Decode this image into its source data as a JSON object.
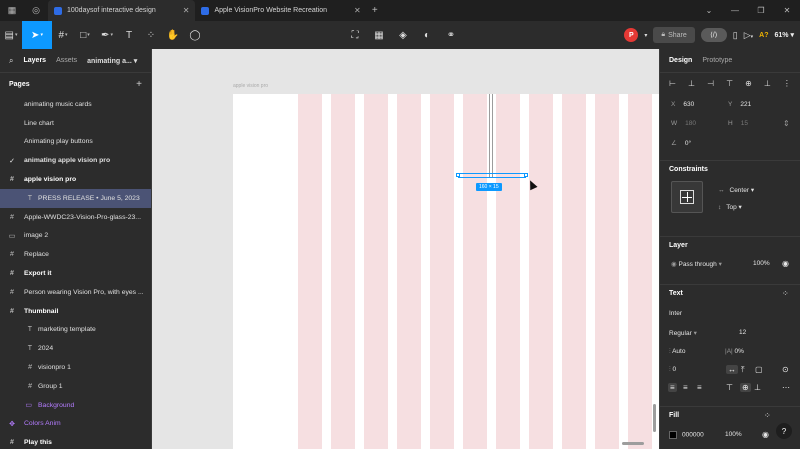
{
  "browser": {
    "tabs": [
      {
        "title": "100daysof interactive design",
        "active": true
      },
      {
        "title": "Apple VisionPro Website Recreation",
        "active": false
      }
    ]
  },
  "toolbar": {
    "avatar_letter": "P",
    "share_label": "Share",
    "ai_label": "A?",
    "zoom": "61%"
  },
  "left_panel": {
    "tab_layers": "Layers",
    "tab_assets": "Assets",
    "page_name": "animating a...",
    "pages_header": "Pages",
    "pages": [
      {
        "label": "animating music cards",
        "checked": false
      },
      {
        "label": "Line chart",
        "checked": false
      },
      {
        "label": "Animating play buttons",
        "checked": false
      },
      {
        "label": "animating apple vision pro",
        "checked": true
      }
    ],
    "layers": [
      {
        "label": "apple vision pro",
        "icon": "#",
        "indent": false,
        "bold": true,
        "highlight": false,
        "purple": false
      },
      {
        "label": "PRESS RELEASE • June 5, 2023",
        "icon": "T",
        "indent": true,
        "bold": false,
        "highlight": true,
        "purple": false
      },
      {
        "label": "Apple-WWDC23-Vision-Pro-glass-23...",
        "icon": "#",
        "indent": false,
        "bold": false,
        "highlight": false,
        "purple": false
      },
      {
        "label": "image 2",
        "icon": "▭",
        "indent": false,
        "bold": false,
        "highlight": false,
        "purple": false
      },
      {
        "label": "Replace",
        "icon": "#",
        "indent": false,
        "bold": false,
        "highlight": false,
        "purple": false
      },
      {
        "label": "Export it",
        "icon": "#",
        "indent": false,
        "bold": true,
        "highlight": false,
        "purple": false
      },
      {
        "label": "Person wearing Vision Pro, with eyes ...",
        "icon": "#",
        "indent": false,
        "bold": false,
        "highlight": false,
        "purple": false
      },
      {
        "label": "Thumbnail",
        "icon": "#",
        "indent": false,
        "bold": true,
        "highlight": false,
        "purple": false
      },
      {
        "label": "marketing template",
        "icon": "T",
        "indent": true,
        "bold": false,
        "highlight": false,
        "purple": false
      },
      {
        "label": "2024",
        "icon": "T",
        "indent": true,
        "bold": false,
        "highlight": false,
        "purple": false
      },
      {
        "label": "visionpro 1",
        "icon": "#",
        "indent": true,
        "bold": false,
        "highlight": false,
        "purple": false
      },
      {
        "label": "Group 1",
        "icon": "#",
        "indent": true,
        "bold": false,
        "highlight": false,
        "purple": false
      },
      {
        "label": "Background",
        "icon": "▭",
        "indent": true,
        "bold": false,
        "highlight": false,
        "purple": true
      },
      {
        "label": "Colors Anim",
        "icon": "✥",
        "indent": false,
        "bold": false,
        "highlight": false,
        "purple": true
      },
      {
        "label": "Play this",
        "icon": "#",
        "indent": false,
        "bold": true,
        "highlight": false,
        "purple": false
      }
    ]
  },
  "canvas": {
    "frame_label": "apple vision pro",
    "selection_size": "160 × 15",
    "background": "#e5e5e5",
    "column_color": "#f6dfe1",
    "column_count": 11,
    "selection_color": "#0d99ff"
  },
  "right_panel": {
    "tab_design": "Design",
    "tab_prototype": "Prototype",
    "x_label": "X",
    "x_value": "630",
    "y_label": "Y",
    "y_value": "221",
    "w_label": "W",
    "w_value": "180",
    "h_label": "H",
    "h_value": "15",
    "rotation": "0°",
    "constraints_title": "Constraints",
    "constraint_h": "Center",
    "constraint_v": "Top",
    "layer_title": "Layer",
    "blend_mode": "Pass through",
    "opacity": "100%",
    "text_title": "Text",
    "font_family": "Inter",
    "font_weight": "Regular",
    "font_size": "12",
    "line_height": "Auto",
    "letter_spacing": "0%",
    "paragraph_spacing": "0",
    "fill_title": "Fill",
    "fill_hex": "000000",
    "fill_opacity": "100%"
  }
}
